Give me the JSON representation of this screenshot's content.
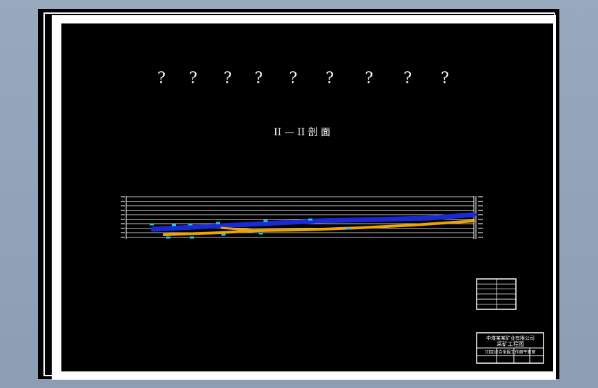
{
  "drawing": {
    "title_placeholders": [
      "?",
      "?",
      "?",
      "?",
      "?",
      "?",
      "?",
      "?",
      "?"
    ],
    "section_title": "II — II 剖   面",
    "colors": {
      "background": "#000000",
      "frame": "#ffffff",
      "seam_upper": "#1a2bd6",
      "seam_lower": "#f0a400",
      "marker": "#22c4f0"
    }
  },
  "legend_table": {
    "rows": [
      [
        "",
        ""
      ],
      [
        "",
        ""
      ],
      [
        "",
        ""
      ],
      [
        "",
        ""
      ],
      [
        "",
        ""
      ],
      [
        "",
        ""
      ]
    ]
  },
  "title_block": {
    "company": "中煤某某矿业有限公司",
    "drawing_name": "采矿工程图",
    "subtitle": "III区综合采掘工作面平面图"
  }
}
